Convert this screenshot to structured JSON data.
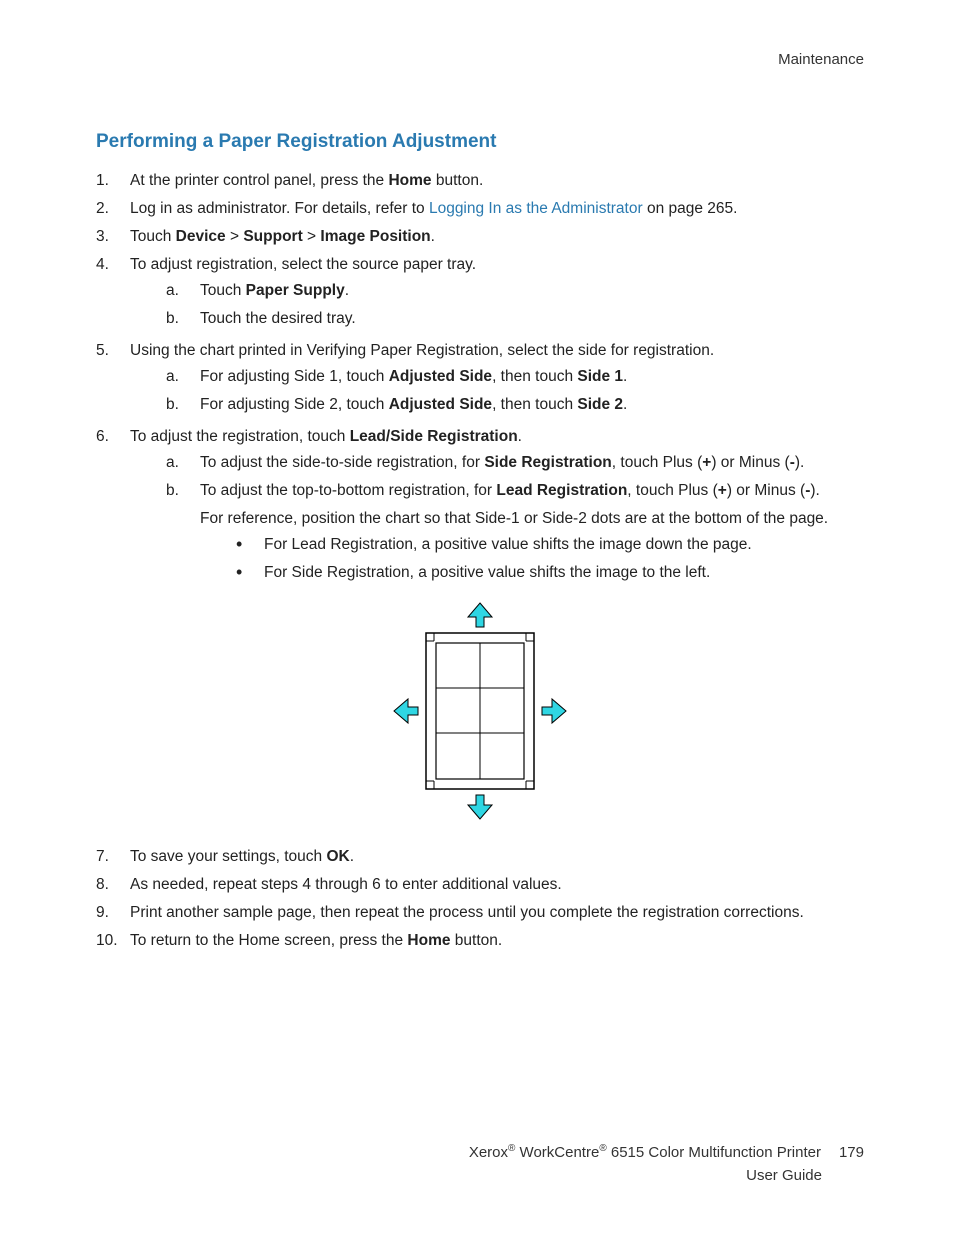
{
  "header": {
    "section": "Maintenance"
  },
  "heading": "Performing a Paper Registration Adjustment",
  "steps": {
    "s1": {
      "n": "1.",
      "pre": "At the printer control panel, press the ",
      "b1": "Home",
      "post": " button."
    },
    "s2": {
      "n": "2.",
      "pre": "Log in as administrator. For details, refer to ",
      "link": "Logging In as the Administrator",
      "post": " on page 265."
    },
    "s3": {
      "n": "3.",
      "pre": "Touch ",
      "b1": "Device",
      "sep1": " > ",
      "b2": "Support",
      "sep2": " > ",
      "b3": "Image Position",
      "post": "."
    },
    "s4": {
      "n": "4.",
      "text": "To adjust registration, select the source paper tray.",
      "a": {
        "n": "a.",
        "pre": "Touch ",
        "b1": "Paper Supply",
        "post": "."
      },
      "b": {
        "n": "b.",
        "text": "Touch the desired tray."
      }
    },
    "s5": {
      "n": "5.",
      "text": "Using the chart printed in Verifying Paper Registration, select the side for registration.",
      "a": {
        "n": "a.",
        "pre": "For adjusting Side 1, touch ",
        "b1": "Adjusted Side",
        "mid": ", then touch ",
        "b2": "Side 1",
        "post": "."
      },
      "b": {
        "n": "b.",
        "pre": "For adjusting Side 2, touch ",
        "b1": "Adjusted Side",
        "mid": ", then touch ",
        "b2": "Side 2",
        "post": "."
      }
    },
    "s6": {
      "n": "6.",
      "pre": "To adjust the registration, touch ",
      "b1": "Lead/Side Registration",
      "post": ".",
      "a": {
        "n": "a.",
        "pre": "To adjust the side-to-side registration, for ",
        "b1": "Side Registration",
        "mid": ", touch Plus (",
        "b2": "+",
        "mid2": ") or Minus (",
        "b3": "-",
        "post": ")."
      },
      "b": {
        "n": "b.",
        "pre": "To adjust the top-to-bottom registration, for ",
        "b1": "Lead Registration",
        "mid": ", touch Plus (",
        "b2": "+",
        "mid2": ") or Minus (",
        "b3": "-",
        "post": ").",
        "line2": "For reference, position the chart so that Side-1 or Side-2 dots are at the bottom of the page.",
        "bul1": "For Lead Registration, a positive value shifts the image down the page.",
        "bul2": "For Side Registration, a positive value shifts the image to the left."
      }
    },
    "s7": {
      "n": "7.",
      "pre": "To save your settings, touch ",
      "b1": "OK",
      "post": "."
    },
    "s8": {
      "n": "8.",
      "text": "As needed, repeat steps 4 through 6 to enter additional values."
    },
    "s9": {
      "n": "9.",
      "text": "Print another sample page, then repeat the process until you complete the registration corrections."
    },
    "s10": {
      "n": "10.",
      "pre": "To return to the Home screen, press the ",
      "b1": "Home",
      "post": " button."
    }
  },
  "footer": {
    "line1_pre": "Xerox",
    "line1_mid": " WorkCentre",
    "line1_post": " 6515 Color Multifunction Printer",
    "page": "179",
    "line2": "User Guide"
  }
}
